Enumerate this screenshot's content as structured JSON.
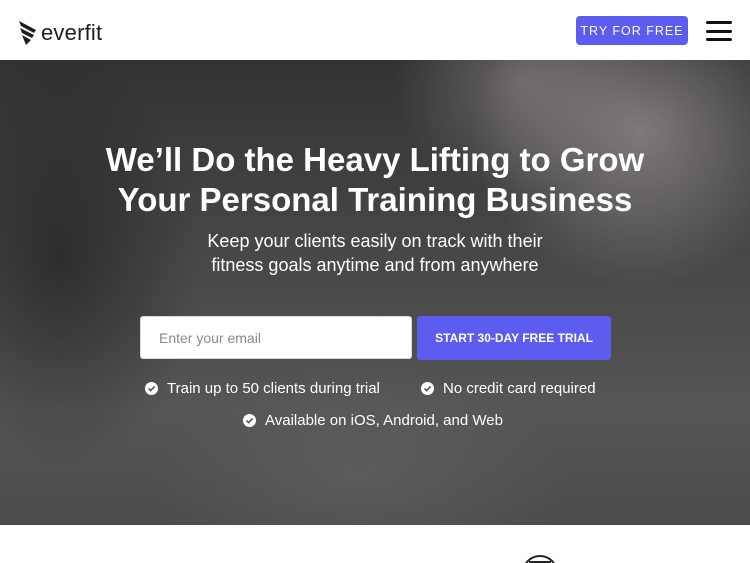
{
  "header": {
    "logo_text": "everfit",
    "try_label": "TRY FOR FREE",
    "menu_icon": "hamburger-menu-icon"
  },
  "hero": {
    "title_line1": "We’ll Do the Heavy Lifting to Grow",
    "title_line2": "Your Personal Training Business",
    "subtitle_line1": "Keep your clients easily on track with their",
    "subtitle_line2": "fitness goals anytime and from anywhere",
    "email_placeholder": "Enter your email",
    "cta_label": "START 30-DAY FREE TRIAL",
    "checks": [
      "Train up to 50 clients during trial",
      "No credit card required",
      "Available on iOS, Android, and Web"
    ]
  },
  "colors": {
    "accent": "#5c5cef",
    "text_dark": "#1e1e1e"
  }
}
